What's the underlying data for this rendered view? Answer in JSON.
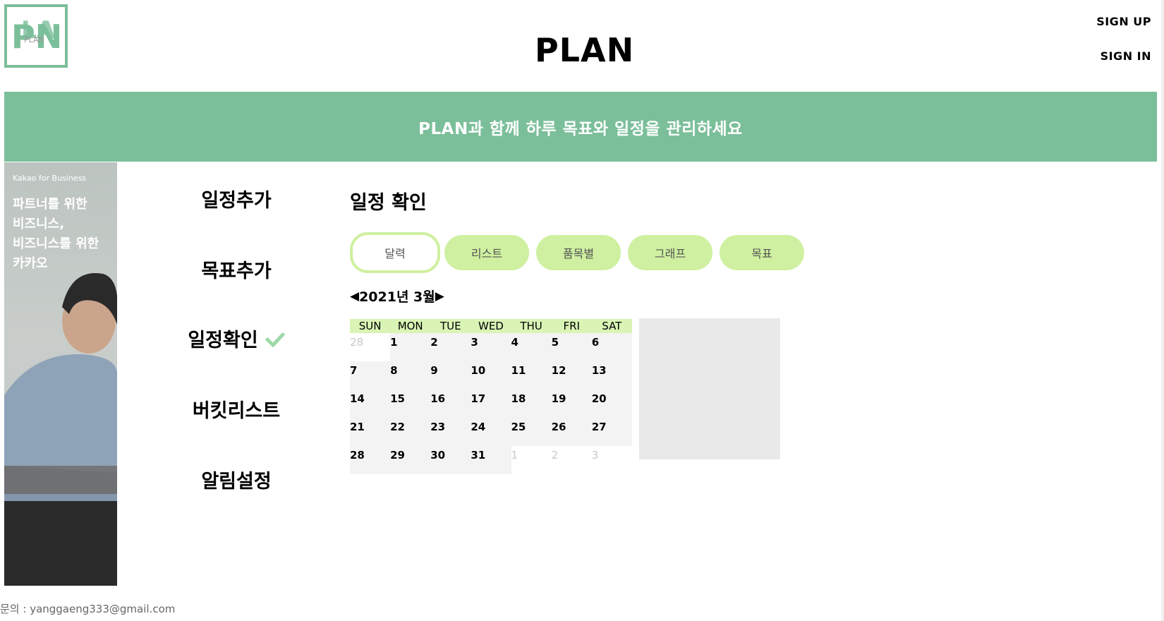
{
  "header": {
    "logo_text": "PLAN",
    "title": "PLAN",
    "signup_label": "SIGN UP",
    "signin_label": "SIGN IN"
  },
  "banner": {
    "text": "PLAN과 함께 하루 목표와 일정을 관리하세요"
  },
  "ad": {
    "brand": "Kakao for Business",
    "lines": [
      "파트너를 위한",
      "비즈니스,",
      "비즈니스를 위한",
      "카카오"
    ]
  },
  "nav": {
    "items": [
      {
        "label": "일정추가"
      },
      {
        "label": "목표추가"
      },
      {
        "label": "일정확인",
        "active": true
      },
      {
        "label": "버킷리스트"
      },
      {
        "label": "알림설정"
      }
    ]
  },
  "main": {
    "title": "일정 확인",
    "tabs": [
      {
        "label": "달력",
        "active": true
      },
      {
        "label": "리스트"
      },
      {
        "label": "품목별"
      },
      {
        "label": "그래프"
      },
      {
        "label": "목표"
      }
    ],
    "month_label": "2021년 3월",
    "prev_arrow": "◀",
    "next_arrow": "▶"
  },
  "calendar": {
    "weekdays": [
      "SUN",
      "MON",
      "TUE",
      "WED",
      "THU",
      "FRI",
      "SAT"
    ],
    "weeks": [
      [
        "28",
        "1",
        "2",
        "3",
        "4",
        "5",
        "6"
      ],
      [
        "7",
        "8",
        "9",
        "10",
        "11",
        "12",
        "13"
      ],
      [
        "14",
        "15",
        "16",
        "17",
        "18",
        "19",
        "20"
      ],
      [
        "21",
        "22",
        "23",
        "24",
        "25",
        "26",
        "27"
      ],
      [
        "28",
        "29",
        "30",
        "31",
        "1",
        "2",
        "3"
      ]
    ]
  },
  "footer": {
    "contact": "문의 : yanggaeng333@gmail.com"
  },
  "colors": {
    "brand_green": "#7bbf9a",
    "tab_green": "#cff0a0",
    "weekday_bg": "#d9f4b5"
  }
}
